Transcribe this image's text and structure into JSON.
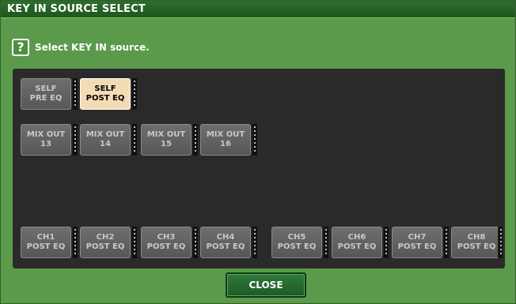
{
  "window": {
    "title": "KEY IN SOURCE SELECT"
  },
  "help": {
    "icon": "?",
    "text": "Select KEY IN source."
  },
  "rows": {
    "self": [
      {
        "line1": "SELF",
        "line2": "PRE EQ",
        "selected": false
      },
      {
        "line1": "SELF",
        "line2": "POST EQ",
        "selected": true
      }
    ],
    "mix": [
      {
        "line1": "MIX OUT",
        "line2": "13"
      },
      {
        "line1": "MIX OUT",
        "line2": "14"
      },
      {
        "line1": "MIX OUT",
        "line2": "15"
      },
      {
        "line1": "MIX OUT",
        "line2": "16"
      }
    ],
    "ch": [
      {
        "line1": "CH1",
        "line2": "POST EQ"
      },
      {
        "line1": "CH2",
        "line2": "POST EQ"
      },
      {
        "line1": "CH3",
        "line2": "POST EQ"
      },
      {
        "line1": "CH4",
        "line2": "POST EQ"
      },
      {
        "line1": "CH5",
        "line2": "POST EQ"
      },
      {
        "line1": "CH6",
        "line2": "POST EQ"
      },
      {
        "line1": "CH7",
        "line2": "POST EQ"
      },
      {
        "line1": "CH8",
        "line2": "POST EQ"
      }
    ]
  },
  "close_label": "CLOSE"
}
